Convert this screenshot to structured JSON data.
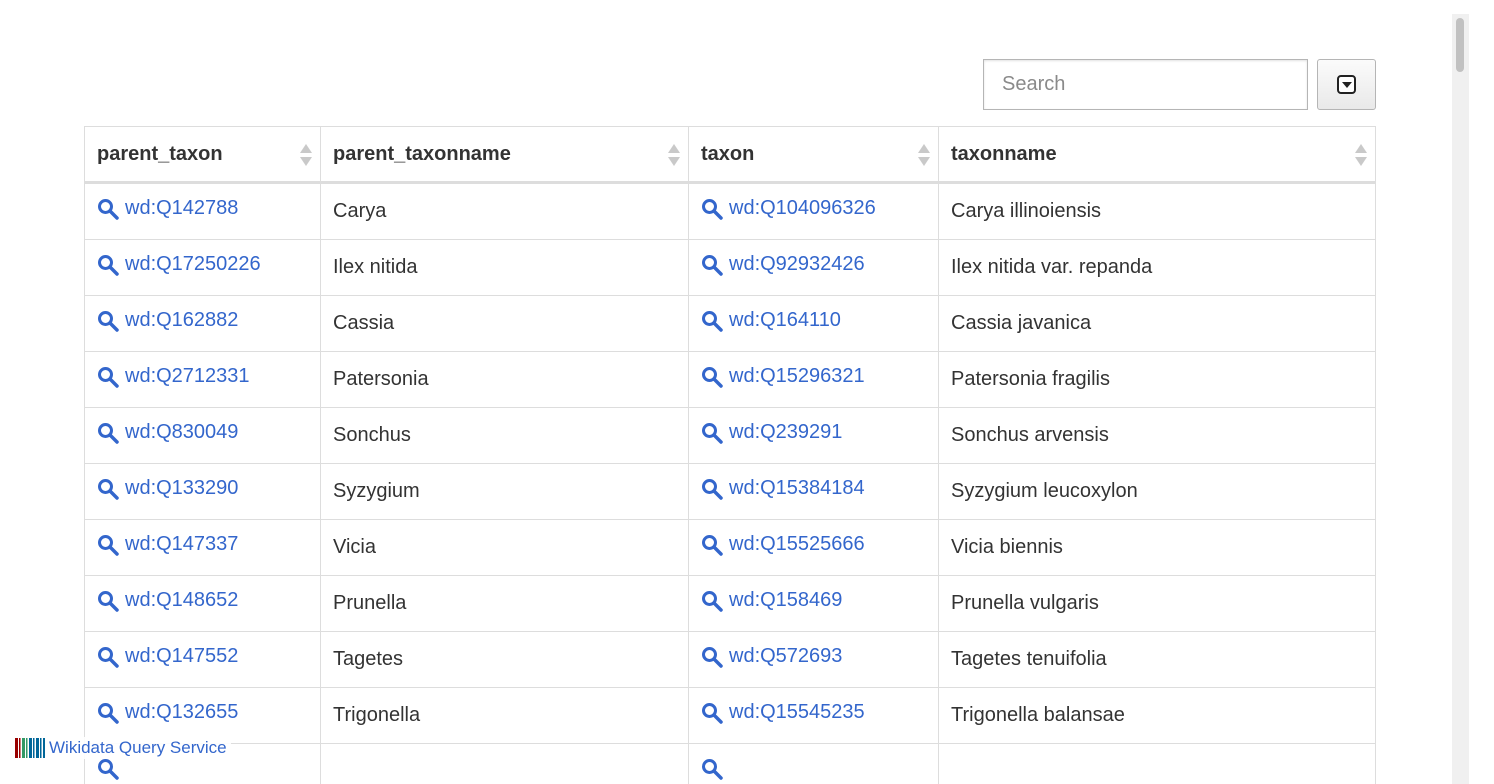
{
  "search": {
    "placeholder": "Search",
    "toggle_icon": "caret-square-down-icon"
  },
  "table": {
    "columns": [
      {
        "key": "parent_taxon",
        "label": "parent_taxon"
      },
      {
        "key": "parent_taxonname",
        "label": "parent_taxonname"
      },
      {
        "key": "taxon",
        "label": "taxon"
      },
      {
        "key": "taxonname",
        "label": "taxonname"
      }
    ],
    "rows": [
      {
        "parent_taxon": "wd:Q142788",
        "parent_taxonname": "Carya",
        "taxon": "wd:Q104096326",
        "taxonname": "Carya illinoiensis"
      },
      {
        "parent_taxon": "wd:Q17250226",
        "parent_taxonname": "Ilex nitida",
        "taxon": "wd:Q92932426",
        "taxonname": "Ilex nitida var. repanda"
      },
      {
        "parent_taxon": "wd:Q162882",
        "parent_taxonname": "Cassia",
        "taxon": "wd:Q164110",
        "taxonname": "Cassia javanica"
      },
      {
        "parent_taxon": "wd:Q2712331",
        "parent_taxonname": "Patersonia",
        "taxon": "wd:Q15296321",
        "taxonname": "Patersonia fragilis"
      },
      {
        "parent_taxon": "wd:Q830049",
        "parent_taxonname": "Sonchus",
        "taxon": "wd:Q239291",
        "taxonname": "Sonchus arvensis"
      },
      {
        "parent_taxon": "wd:Q133290",
        "parent_taxonname": "Syzygium",
        "taxon": "wd:Q15384184",
        "taxonname": "Syzygium leucoxylon"
      },
      {
        "parent_taxon": "wd:Q147337",
        "parent_taxonname": "Vicia",
        "taxon": "wd:Q15525666",
        "taxonname": "Vicia biennis"
      },
      {
        "parent_taxon": "wd:Q148652",
        "parent_taxonname": "Prunella",
        "taxon": "wd:Q158469",
        "taxonname": "Prunella vulgaris"
      },
      {
        "parent_taxon": "wd:Q147552",
        "parent_taxonname": "Tagetes",
        "taxon": "wd:Q572693",
        "taxonname": "Tagetes tenuifolia"
      },
      {
        "parent_taxon": "wd:Q132655",
        "parent_taxonname": "Trigonella",
        "taxon": "wd:Q15545235",
        "taxonname": "Trigonella balansae"
      },
      {
        "parent_taxon": "",
        "parent_taxonname": "",
        "taxon": "",
        "taxonname": ""
      }
    ]
  },
  "footer": {
    "brand_name": "Wikidata Query Service",
    "logo_icon": "wikidata-barcode-logo-icon"
  },
  "colors": {
    "link": "#3366cc",
    "border": "#dddddd",
    "text": "#333333"
  }
}
